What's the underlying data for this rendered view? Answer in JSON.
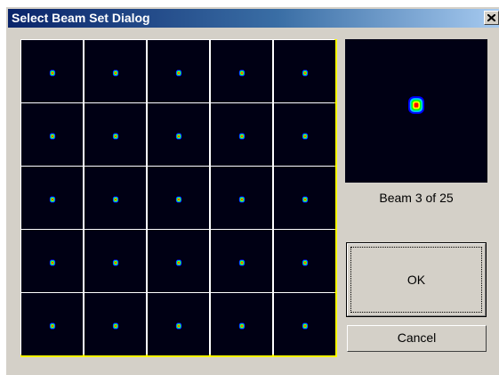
{
  "window": {
    "title": "Select Beam Set Dialog",
    "close_icon": "close-icon"
  },
  "beam_grid": {
    "rows": 5,
    "columns": 5,
    "selected_beam": 3,
    "total_beams": 25,
    "selection_border_color": "#ffff00",
    "cell_background": "#000014",
    "beam_colors": [
      "#ff0000",
      "#ffff00",
      "#00ff00",
      "#00ccff",
      "#0000ff"
    ]
  },
  "preview": {
    "label": "Beam 3 of 25"
  },
  "buttons": {
    "ok_label": "OK",
    "cancel_label": "Cancel"
  }
}
